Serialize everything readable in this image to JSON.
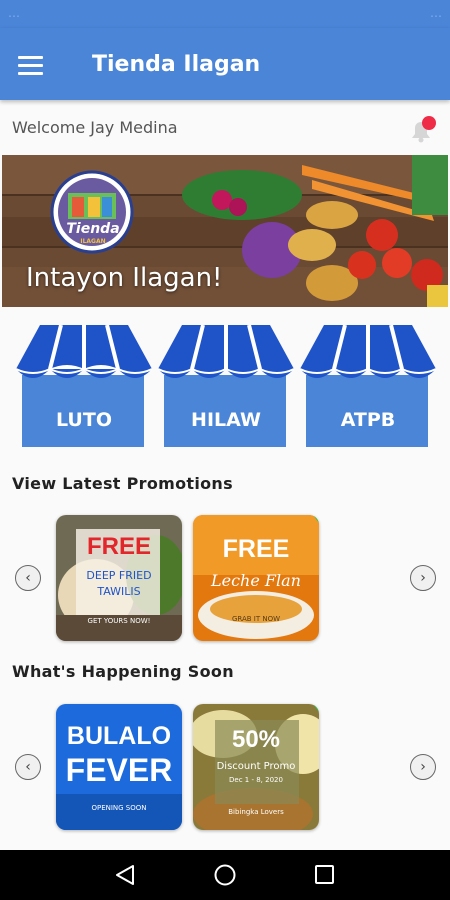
{
  "status_bar": {
    "left_text": "…",
    "right_text": "…"
  },
  "app_bar": {
    "title": "Tienda Ilagan"
  },
  "welcome": {
    "text": "Welcome Jay Medina"
  },
  "banner": {
    "logo_text": "Tienda",
    "logo_sub": "ILAGAN",
    "tagline": "Intayon Ilagan!"
  },
  "stores": [
    {
      "label": "LUTO"
    },
    {
      "label": "HILAW"
    },
    {
      "label": "ATPB"
    }
  ],
  "promotions": {
    "title": "View Latest Promotions",
    "cards": [
      {
        "headline": "FREE",
        "line1": "DEEP FRIED",
        "line2": "TAWILIS",
        "footer": "GET YOURS NOW!"
      },
      {
        "headline": "FREE",
        "line1": "Leche Flan",
        "line2": "",
        "footer": "GRAB IT NOW"
      }
    ]
  },
  "happening": {
    "title": "What's Happening Soon",
    "cards": [
      {
        "headline": "BULALO",
        "line1": "FEVER",
        "footer": "OPENING SOON"
      },
      {
        "headline": "50%",
        "line1": "Discount Promo",
        "line2": "Dec 1 - 8, 2020",
        "footer": "Bibingka Lovers"
      }
    ]
  },
  "colors": {
    "primary": "#4a85d8",
    "awning": "#1f53c8",
    "notification": "#ef2c48"
  }
}
